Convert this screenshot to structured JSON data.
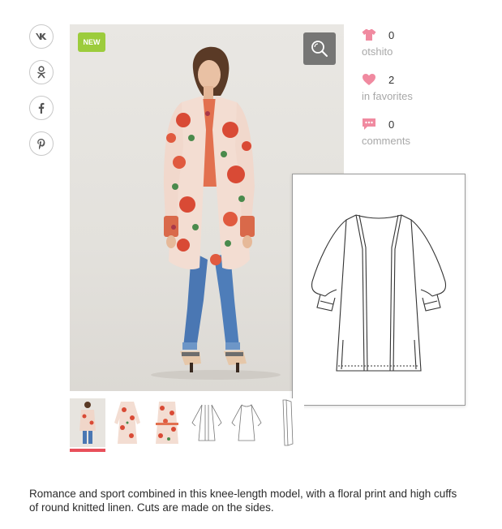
{
  "social": [
    {
      "name": "vk-share-button",
      "icon": "vk-icon"
    },
    {
      "name": "odnoklassniki-share-button",
      "icon": "odnoklassniki-icon"
    },
    {
      "name": "facebook-share-button",
      "icon": "facebook-icon"
    },
    {
      "name": "pinterest-share-button",
      "icon": "pinterest-icon"
    }
  ],
  "badge": {
    "label": "NEW",
    "color": "#9ccc3c"
  },
  "stats": [
    {
      "icon": "tshirt-icon",
      "count": "0",
      "label": "otshito"
    },
    {
      "icon": "heart-icon",
      "count": "2",
      "label": "in favorites"
    },
    {
      "icon": "comment-icon",
      "count": "0",
      "label": "comments"
    }
  ],
  "accent_color": "#e8505b",
  "stat_icon_color": "#f08aa0",
  "description": "Romance and sport combined in this knee-length model, with a floral print and high cuffs of round knitted linen. Cuts are made on the sides."
}
